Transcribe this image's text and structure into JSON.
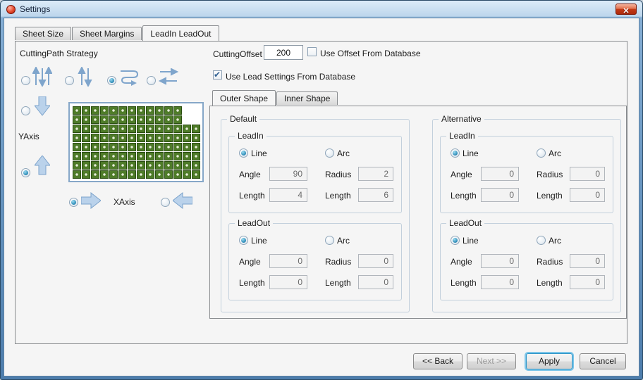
{
  "titlebar": {
    "title": "Settings",
    "close_glyph": "✕"
  },
  "main_tabs": [
    {
      "label": "Sheet Size"
    },
    {
      "label": "Sheet Margins"
    },
    {
      "label": "LeadIn LeadOut"
    }
  ],
  "cutting": {
    "strategy_label": "CuttingPath Strategy",
    "yaxis_label": "YAxis",
    "xaxis_label": "XAxis"
  },
  "offset": {
    "label": "CuttingOffset",
    "value": "200",
    "use_offset_checkbox_label": "Use Offset From Database",
    "use_lead_checkbox_label": "Use Lead Settings From Database"
  },
  "shape_tabs": [
    {
      "label": "Outer Shape"
    },
    {
      "label": "Inner Shape"
    }
  ],
  "lead_groups": [
    {
      "title": "Default",
      "sections": [
        {
          "title": "LeadIn",
          "line_label": "Line",
          "arc_label": "Arc",
          "angle_label": "Angle",
          "angle": "90",
          "radius_label": "Radius",
          "radius": "2",
          "length_label": "Length",
          "length1": "4",
          "length2": "6"
        },
        {
          "title": "LeadOut",
          "line_label": "Line",
          "arc_label": "Arc",
          "angle_label": "Angle",
          "angle": "0",
          "radius_label": "Radius",
          "radius": "0",
          "length_label": "Length",
          "length1": "0",
          "length2": "0"
        }
      ]
    },
    {
      "title": "Alternative",
      "sections": [
        {
          "title": "LeadIn",
          "line_label": "Line",
          "arc_label": "Arc",
          "angle_label": "Angle",
          "angle": "0",
          "radius_label": "Radius",
          "radius": "0",
          "length_label": "Length",
          "length1": "0",
          "length2": "0"
        },
        {
          "title": "LeadOut",
          "line_label": "Line",
          "arc_label": "Arc",
          "angle_label": "Angle",
          "angle": "0",
          "radius_label": "Radius",
          "radius": "0",
          "length_label": "Length",
          "length1": "0",
          "length2": "0"
        }
      ]
    }
  ],
  "preview": {
    "rows": 8,
    "cols": 14,
    "notch_rows": 2,
    "notch_cols": 2
  },
  "footer": {
    "back": "<< Back",
    "next": "Next >>",
    "apply": "Apply",
    "cancel": "Cancel"
  },
  "colors": {
    "accent_focus": "#2f96c8",
    "part_green": "#4e7b28",
    "arrow_blue": "#bad2eb"
  }
}
